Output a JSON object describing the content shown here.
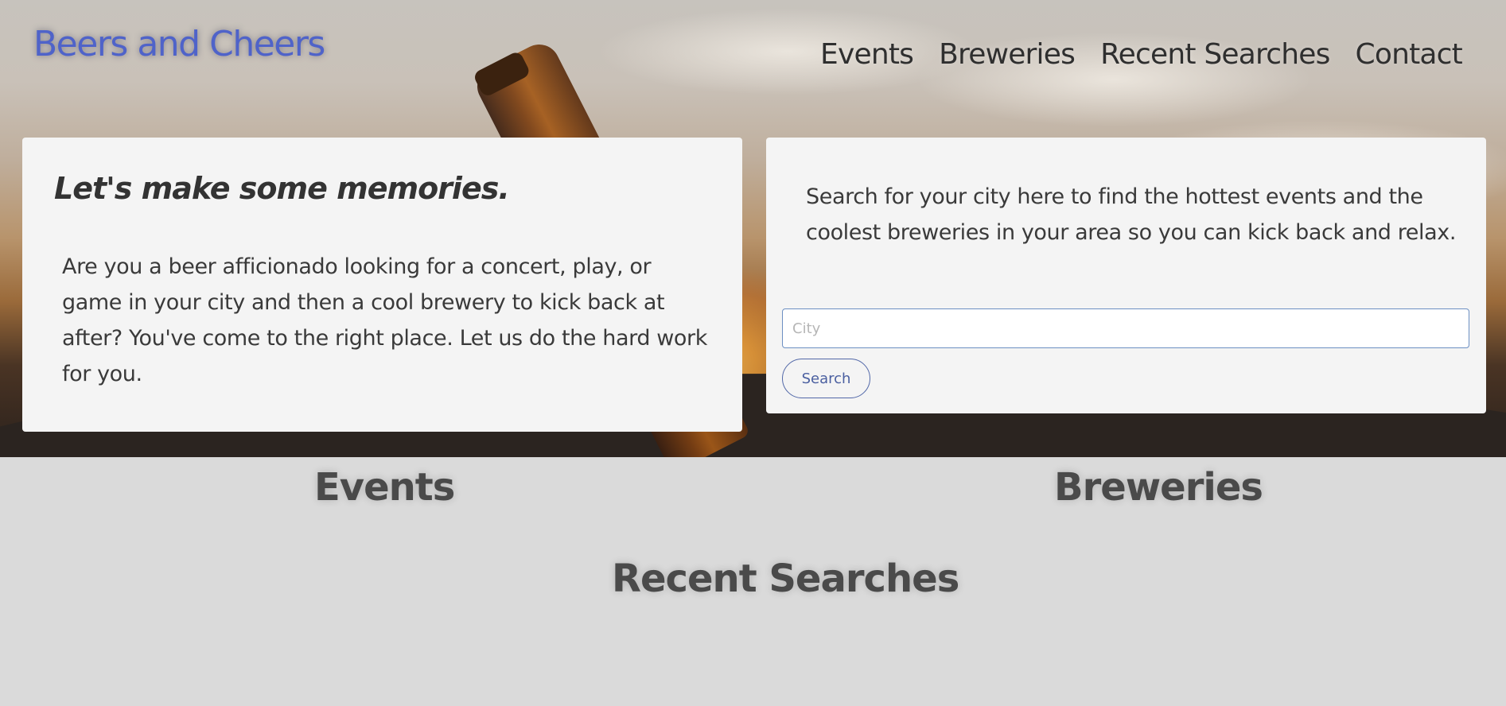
{
  "header": {
    "brand": "Beers and Cheers",
    "nav": [
      "Events",
      "Breweries",
      "Recent Searches",
      "Contact"
    ]
  },
  "intro_card": {
    "title": "Let's make some memories.",
    "body": "Are you a beer afficionado looking for a concert, play, or game in your city and then a cool brewery to kick back at after? You've come to the right place. Let us do the hard work for you."
  },
  "search_card": {
    "body": "Search for your city here to find the hottest events and the coolest breweries in your area so you can kick back and relax.",
    "input_placeholder": "City",
    "input_value": "",
    "button_label": "Search"
  },
  "sections": {
    "events": "Events",
    "breweries": "Breweries",
    "recent": "Recent Searches"
  },
  "colors": {
    "brand": "#4f63c9",
    "card": "#f4f4f4",
    "page_bg": "#dadada",
    "button_border": "#5268a8"
  },
  "background_image": "sunset-beer-bottle-photo"
}
